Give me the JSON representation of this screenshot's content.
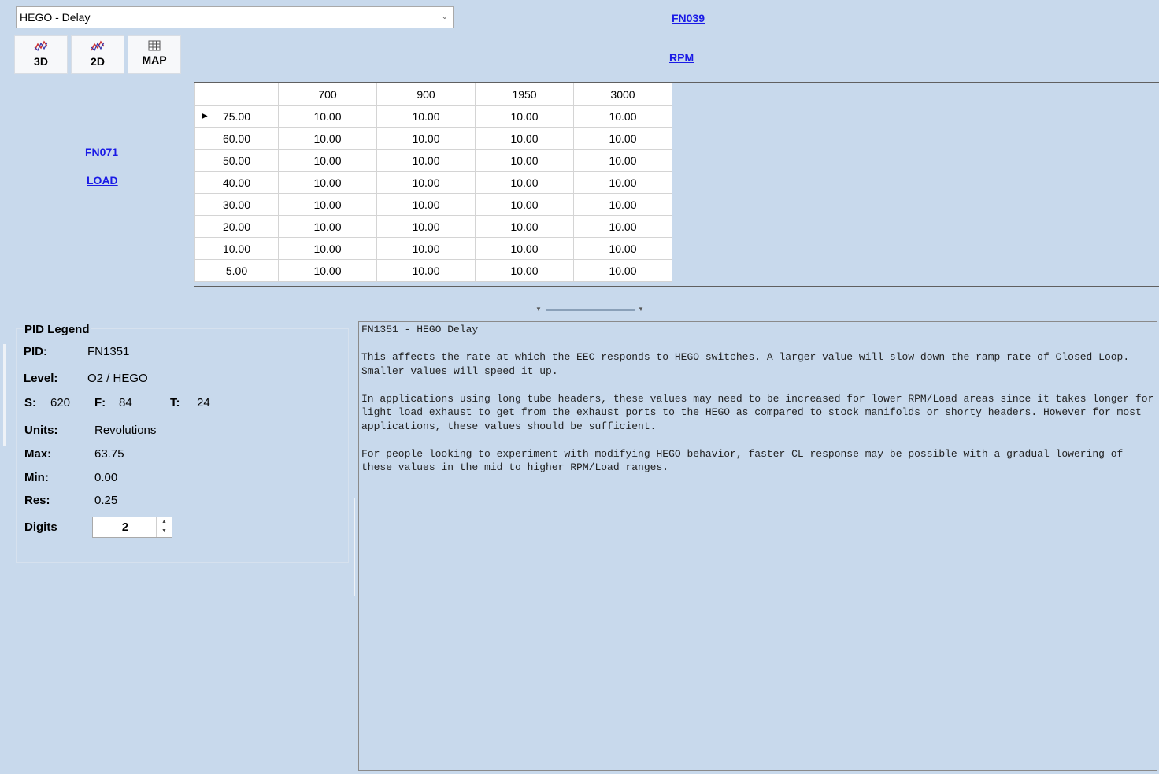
{
  "selector": {
    "value": "HEGO - Delay"
  },
  "toolbar": {
    "btn3d": "3D",
    "btn2d": "2D",
    "btnmap": "MAP"
  },
  "x_axis": {
    "fn": "FN039",
    "name": "RPM"
  },
  "y_axis": {
    "fn": "FN071",
    "name": "LOAD"
  },
  "grid": {
    "columns": [
      "700",
      "900",
      "1950",
      "3000"
    ],
    "rows": [
      {
        "label": "75.00",
        "values": [
          "10.00",
          "10.00",
          "10.00",
          "10.00"
        ]
      },
      {
        "label": "60.00",
        "values": [
          "10.00",
          "10.00",
          "10.00",
          "10.00"
        ]
      },
      {
        "label": "50.00",
        "values": [
          "10.00",
          "10.00",
          "10.00",
          "10.00"
        ]
      },
      {
        "label": "40.00",
        "values": [
          "10.00",
          "10.00",
          "10.00",
          "10.00"
        ]
      },
      {
        "label": "30.00",
        "values": [
          "10.00",
          "10.00",
          "10.00",
          "10.00"
        ]
      },
      {
        "label": "20.00",
        "values": [
          "10.00",
          "10.00",
          "10.00",
          "10.00"
        ]
      },
      {
        "label": "10.00",
        "values": [
          "10.00",
          "10.00",
          "10.00",
          "10.00"
        ]
      },
      {
        "label": "5.00",
        "values": [
          "10.00",
          "10.00",
          "10.00",
          "10.00"
        ]
      }
    ]
  },
  "legend": {
    "title": "PID Legend",
    "pid_label": "PID:",
    "pid": "FN1351",
    "level_label": "Level:",
    "level": "O2 / HEGO",
    "s_label": "S:",
    "s": "620",
    "f_label": "F:",
    "f": "84",
    "t_label": "T:",
    "t": "24",
    "units_label": "Units:",
    "units": "Revolutions",
    "max_label": "Max:",
    "max": "63.75",
    "min_label": "Min:",
    "min": "0.00",
    "res_label": "Res:",
    "res": "0.25",
    "digits_label": "Digits",
    "digits": "2"
  },
  "description": {
    "heading": "FN1351 - HEGO Delay",
    "p1": "This affects the rate at which the EEC responds to HEGO switches. A larger value will slow down the ramp rate of Closed Loop. Smaller values will speed it up.",
    "p2": "In applications using long tube headers, these values may need to be increased for lower RPM/Load areas since it takes longer for light load exhaust to get from the exhaust ports to the HEGO as compared to stock manifolds or shorty headers. However for most applications, these values should be sufficient.",
    "p3": "For people looking to experiment with modifying HEGO behavior, faster CL response may be possible with a gradual lowering of these values in the mid to higher RPM/Load ranges."
  }
}
